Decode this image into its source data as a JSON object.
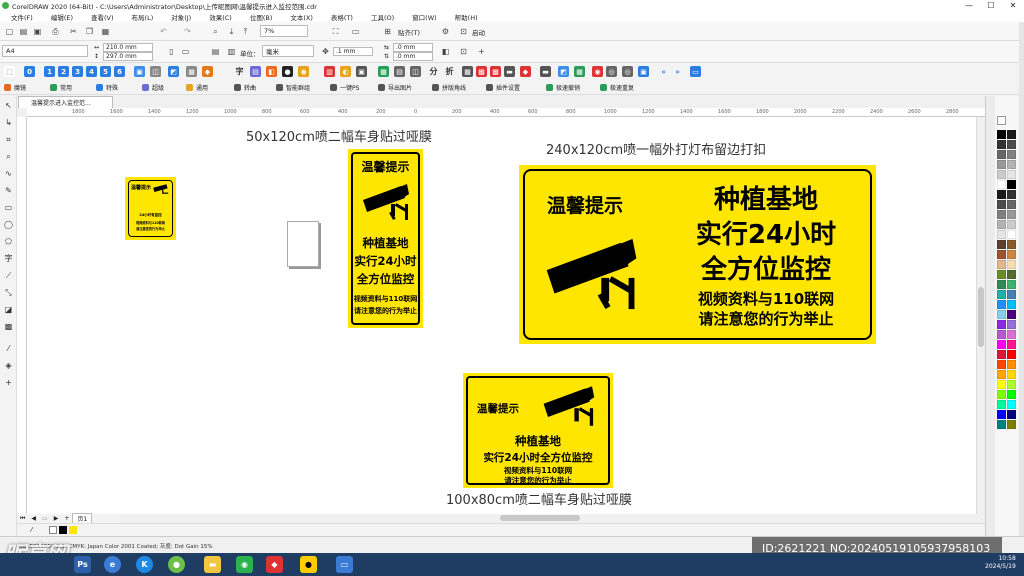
{
  "window": {
    "title": "CorelDRAW 2020 (64-Bit) - C:\\Users\\Administrator\\Desktop\\上传昵图网\\温馨提示进入监控范围.cdr",
    "minimize": "—",
    "maximize": "☐",
    "close": "✕"
  },
  "menu": [
    "文件(F)",
    "编辑(E)",
    "查看(V)",
    "布局(L)",
    "对象(J)",
    "效果(C)",
    "位图(B)",
    "文本(X)",
    "表格(T)",
    "工具(O)",
    "窗口(W)",
    "帮助(H)"
  ],
  "toolbar": {
    "zoom": "7%",
    "snap": "贴齐(T)",
    "launch": "启动"
  },
  "propbar": {
    "page_size": "A4",
    "width": "210.0 mm",
    "height": "297.0 mm",
    "units_label": "单位：",
    "units": "毫米",
    "nudge": ".1 mm",
    "dup_x": ".0 mm",
    "dup_y": ".0 mm"
  },
  "plugin_row1": [
    "0",
    "1",
    "2",
    "3",
    "4",
    "5",
    "6"
  ],
  "plugin_row2": [
    "魔镜",
    "常用",
    "特殊",
    "超级",
    "通用",
    "转曲",
    "智能群组",
    "一键PS",
    "导出图片",
    "拼版角线",
    "插件设置",
    "极速撤销",
    "极速重复"
  ],
  "doc_tab": "温馨提示进入监控范...",
  "ruler_marks": [
    "1800",
    "1600",
    "1400",
    "1200",
    "1000",
    "800",
    "600",
    "400",
    "200",
    "0",
    "200",
    "400",
    "600",
    "800",
    "1000",
    "1200",
    "1400",
    "1600",
    "1800",
    "2000",
    "2200",
    "2400",
    "2600",
    "2800",
    "3000",
    "3200",
    "3400"
  ],
  "canvas": {
    "label_small": "50x120cm喷二幅车身贴过哑膜",
    "label_large": "240x120cm喷一幅外打灯布留边打扣",
    "label_bottom": "100x80cm喷二幅车身贴过哑膜"
  },
  "sign_tiny": {
    "line1": "温馨提示",
    "line2": "24小时有监控",
    "line3": "视频资料与110联网",
    "line4": "请注意您的行为举止"
  },
  "sign_vertical": {
    "title": "温馨提示",
    "line1": "种植基地",
    "line2": "实行24小时",
    "line3": "全方位监控",
    "line4": "视频资料与110联网",
    "line5": "请注意您的行为举止"
  },
  "sign_large": {
    "title": "温馨提示",
    "line1": "种植基地",
    "line2": "实行24小时",
    "line3": "全方位监控",
    "line4": "视频资料与110联网",
    "line5": "请注意您的行为举止"
  },
  "sign_medium": {
    "title": "温馨提示",
    "line1": "种植基地",
    "line2": "实行24小时全方位监控",
    "line3": "视频资料与110联网",
    "line4": "请注意您的行为举止"
  },
  "page_nav": "页1",
  "status": "GB IEC61966-2.1; CMYK: Japan Color 2001 Coated; 灰度: Dot Gain 15%",
  "watermark": {
    "logo": "昵享网",
    "id": "ID:2621221 NO:20240519105937958103"
  },
  "clock": {
    "time": "10:58",
    "date": "2024/5/19"
  },
  "colors": {
    "sign_yellow": "#ffe600",
    "taskbar": "#1f3c63"
  }
}
